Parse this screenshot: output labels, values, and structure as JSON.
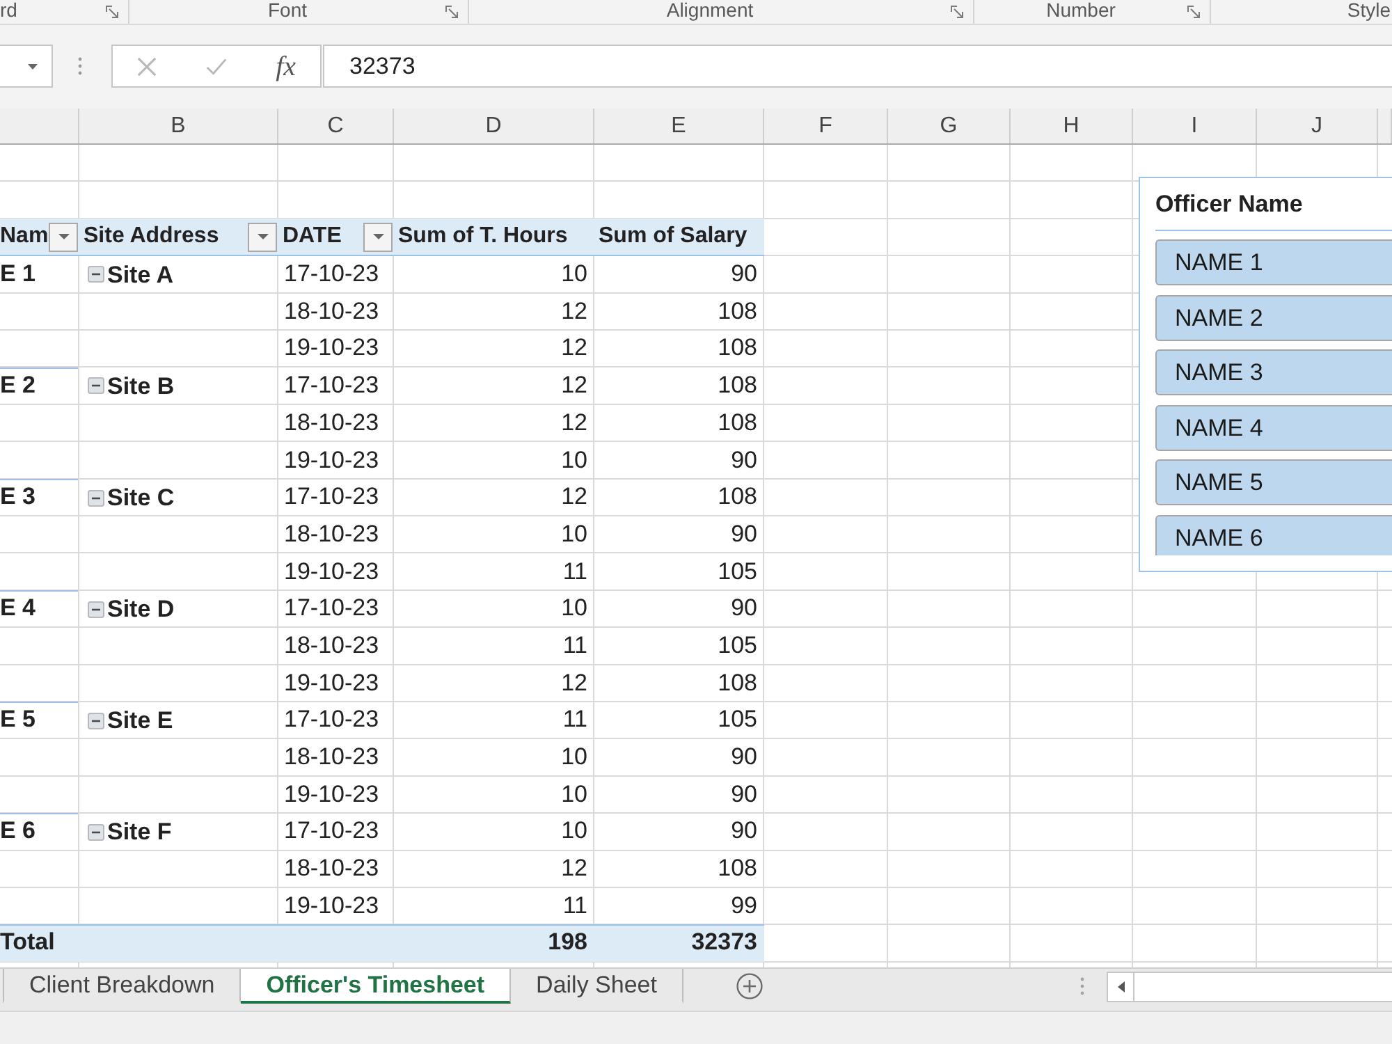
{
  "ribbon": {
    "groups": [
      {
        "label": "rd",
        "launcher": true
      },
      {
        "label": "Font",
        "launcher": true
      },
      {
        "label": "Alignment",
        "launcher": true
      },
      {
        "label": "Number",
        "launcher": true
      },
      {
        "label": "Style",
        "launcher": false
      }
    ]
  },
  "formula_bar": {
    "editing": false,
    "function_label": "fx",
    "value": "32373"
  },
  "columns": [
    "B",
    "C",
    "D",
    "E",
    "F",
    "G",
    "H",
    "I",
    "J"
  ],
  "pivot": {
    "headers": [
      {
        "label": "Nam",
        "filter": true
      },
      {
        "label": "Site Address",
        "filter": true
      },
      {
        "label": "DATE",
        "filter": true
      },
      {
        "label": "Sum of T. Hours",
        "filter": false
      },
      {
        "label": "Sum of Salary",
        "filter": false
      }
    ],
    "groups": [
      {
        "officer": "E 1",
        "site": "Site A",
        "expanded": true,
        "rows": [
          {
            "date": "17-10-23",
            "hours": "10",
            "salary": "90"
          },
          {
            "date": "18-10-23",
            "hours": "12",
            "salary": "108"
          },
          {
            "date": "19-10-23",
            "hours": "12",
            "salary": "108"
          }
        ]
      },
      {
        "officer": "E 2",
        "site": "Site B",
        "expanded": true,
        "rows": [
          {
            "date": "17-10-23",
            "hours": "12",
            "salary": "108"
          },
          {
            "date": "18-10-23",
            "hours": "12",
            "salary": "108"
          },
          {
            "date": "19-10-23",
            "hours": "10",
            "salary": "90"
          }
        ]
      },
      {
        "officer": "E 3",
        "site": "Site C",
        "expanded": true,
        "rows": [
          {
            "date": "17-10-23",
            "hours": "12",
            "salary": "108"
          },
          {
            "date": "18-10-23",
            "hours": "10",
            "salary": "90"
          },
          {
            "date": "19-10-23",
            "hours": "11",
            "salary": "105"
          }
        ]
      },
      {
        "officer": "E 4",
        "site": "Site D",
        "expanded": true,
        "rows": [
          {
            "date": "17-10-23",
            "hours": "10",
            "salary": "90"
          },
          {
            "date": "18-10-23",
            "hours": "11",
            "salary": "105"
          },
          {
            "date": "19-10-23",
            "hours": "12",
            "salary": "108"
          }
        ]
      },
      {
        "officer": "E 5",
        "site": "Site E",
        "expanded": true,
        "rows": [
          {
            "date": "17-10-23",
            "hours": "11",
            "salary": "105"
          },
          {
            "date": "18-10-23",
            "hours": "10",
            "salary": "90"
          },
          {
            "date": "19-10-23",
            "hours": "10",
            "salary": "90"
          }
        ]
      },
      {
        "officer": "E 6",
        "site": "Site F",
        "expanded": true,
        "rows": [
          {
            "date": "17-10-23",
            "hours": "10",
            "salary": "90"
          },
          {
            "date": "18-10-23",
            "hours": "12",
            "salary": "108"
          },
          {
            "date": "19-10-23",
            "hours": "11",
            "salary": "99"
          }
        ]
      }
    ],
    "total": {
      "label": "Total",
      "hours": "198",
      "salary": "32373"
    }
  },
  "slicer": {
    "title": "Officer Name",
    "items": [
      {
        "label": "NAME 1",
        "selected": true
      },
      {
        "label": "NAME 2",
        "selected": true
      },
      {
        "label": "NAME 3",
        "selected": true
      },
      {
        "label": "NAME 4",
        "selected": true
      },
      {
        "label": "NAME 5",
        "selected": true
      },
      {
        "label": "NAME 6",
        "selected": true
      }
    ]
  },
  "sheet_tabs": [
    {
      "label": "Client Breakdown",
      "selected": false
    },
    {
      "label": "Officer's Timesheet",
      "selected": true
    },
    {
      "label": "Daily Sheet",
      "selected": false
    }
  ]
}
